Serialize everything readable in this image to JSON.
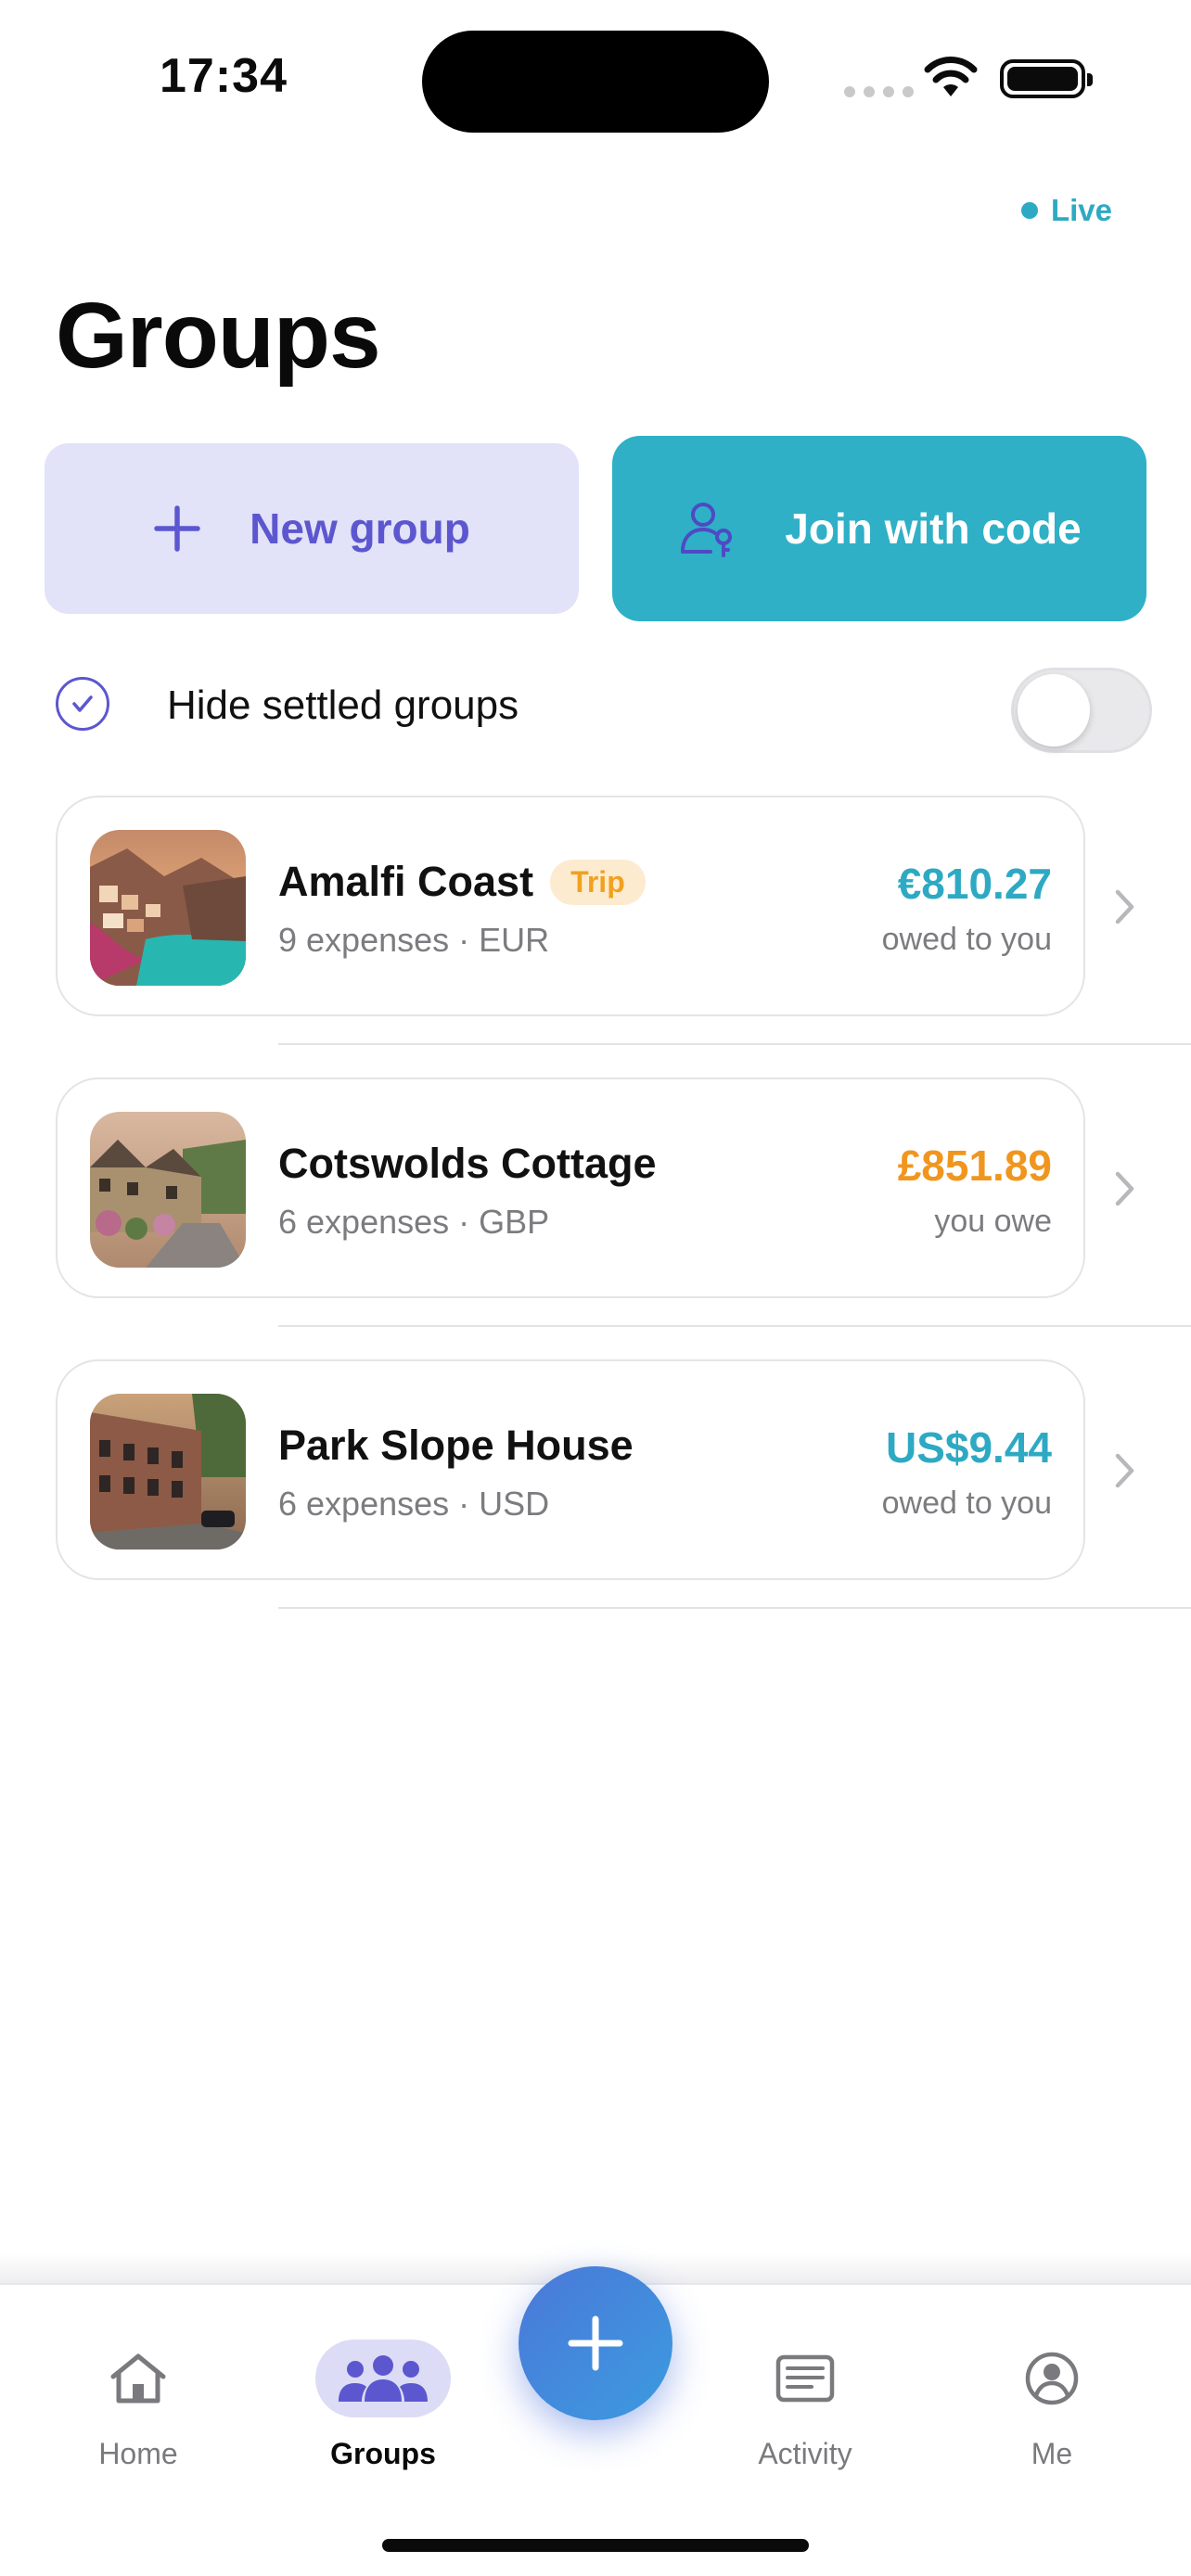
{
  "status_bar": {
    "time": "17:34"
  },
  "live": {
    "label": "Live",
    "color": "#2ea9c3"
  },
  "page": {
    "title": "Groups"
  },
  "actions": {
    "new_group": {
      "label": "New group",
      "icon": "plus-icon"
    },
    "join_code": {
      "label": "Join with code",
      "icon": "person-key-icon"
    }
  },
  "filter": {
    "label": "Hide settled groups",
    "toggle_on": false
  },
  "groups": [
    {
      "name": "Amalfi Coast",
      "tag": "Trip",
      "meta": "9 expenses · EUR",
      "amount": "€810.27",
      "status": "owed to you",
      "amount_color": "#2ea9c3"
    },
    {
      "name": "Cotswolds Cottage",
      "tag": "",
      "meta": "6 expenses · GBP",
      "amount": "£851.89",
      "status": "you owe",
      "amount_color": "#f0961e"
    },
    {
      "name": "Park Slope House",
      "tag": "",
      "meta": "6 expenses · USD",
      "amount": "US$9.44",
      "status": "owed to you",
      "amount_color": "#2ea9c3"
    }
  ],
  "tabs": {
    "home": "Home",
    "groups": "Groups",
    "activity": "Activity",
    "me": "Me"
  },
  "colors": {
    "accent": "#5c57cf",
    "teal": "#2fb0c7",
    "orange": "#f0961e"
  }
}
